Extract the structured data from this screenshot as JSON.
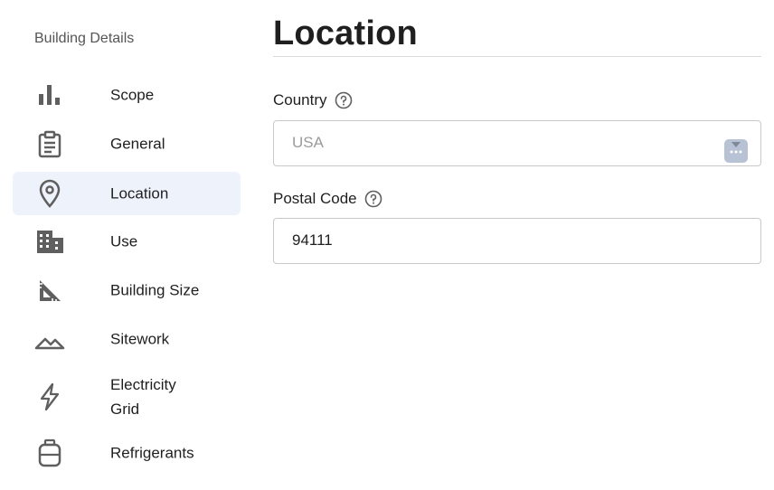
{
  "sidebar": {
    "heading": "Building Details",
    "items": [
      {
        "label": "Scope",
        "icon": "bar-chart-icon"
      },
      {
        "label": "General",
        "icon": "clipboard-icon"
      },
      {
        "label": "Location",
        "icon": "map-pin-icon",
        "active": true
      },
      {
        "label": "Use",
        "icon": "building-icon"
      },
      {
        "label": "Building Size",
        "icon": "triangle-ruler-icon"
      },
      {
        "label": "Sitework",
        "icon": "mountains-icon"
      },
      {
        "label": "Electricity\nGrid",
        "icon": "lightning-icon"
      },
      {
        "label": "Refrigerants",
        "icon": "tank-icon"
      }
    ]
  },
  "main": {
    "title": "Location",
    "country": {
      "label": "Country",
      "placeholder": "USA"
    },
    "postal": {
      "label": "Postal Code",
      "value": "94111"
    }
  },
  "colors": {
    "active_bg": "#eef2fb",
    "icon": "#5f5f5f",
    "select_btn": "#b7c3d4"
  }
}
